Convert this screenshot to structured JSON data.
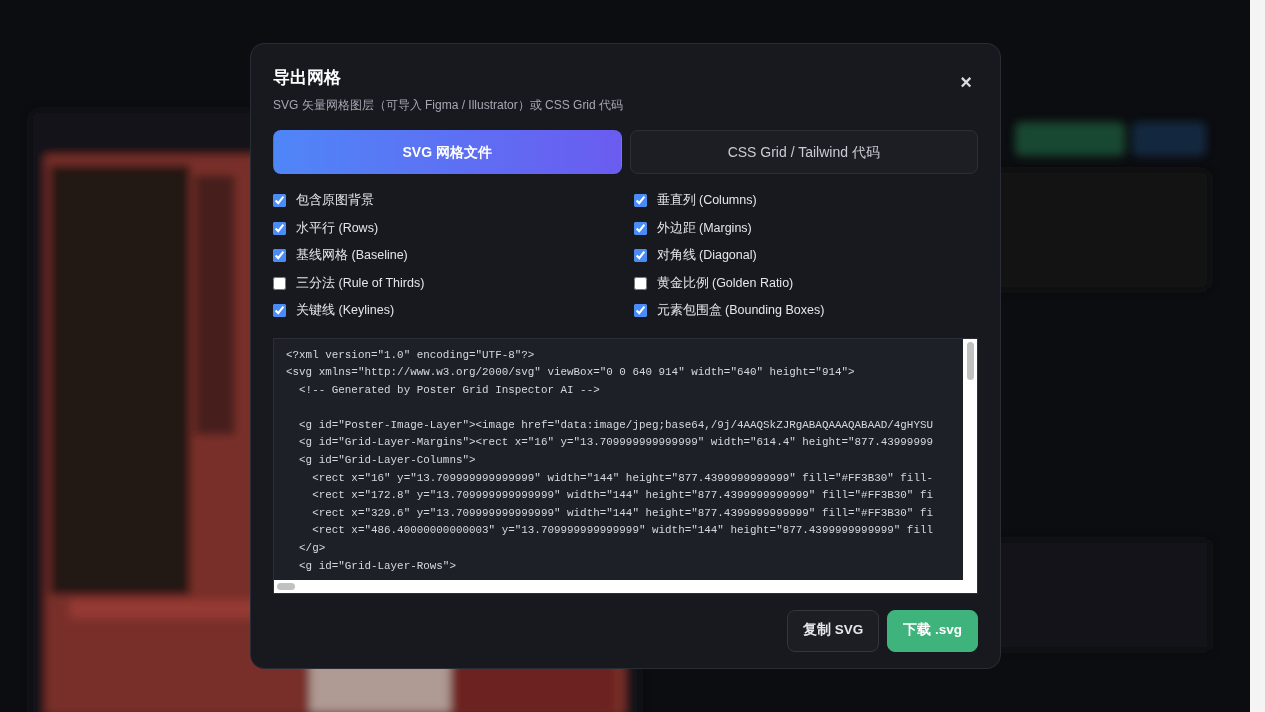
{
  "dialog": {
    "title": "导出网格",
    "subtitle": "SVG 矢量网格图层（可导入 Figma / Illustrator）或 CSS Grid 代码",
    "close": "×"
  },
  "tabs": [
    {
      "label": "SVG 网格文件",
      "selected": true
    },
    {
      "label": "CSS Grid / Tailwind 代码",
      "selected": false
    }
  ],
  "options": [
    {
      "label": "包含原图背景",
      "checked": true
    },
    {
      "label": "垂直列 (Columns)",
      "checked": true
    },
    {
      "label": "水平行 (Rows)",
      "checked": true
    },
    {
      "label": "外边距 (Margins)",
      "checked": true
    },
    {
      "label": "基线网格 (Baseline)",
      "checked": true
    },
    {
      "label": "对角线 (Diagonal)",
      "checked": true
    },
    {
      "label": "三分法 (Rule of Thirds)",
      "checked": false
    },
    {
      "label": "黄金比例 (Golden Ratio)",
      "checked": false
    },
    {
      "label": "关键线 (Keylines)",
      "checked": true
    },
    {
      "label": "元素包围盒 (Bounding Boxes)",
      "checked": true
    }
  ],
  "code": "<?xml version=\"1.0\" encoding=\"UTF-8\"?>\n<svg xmlns=\"http://www.w3.org/2000/svg\" viewBox=\"0 0 640 914\" width=\"640\" height=\"914\">\n  <!-- Generated by Poster Grid Inspector AI -->\n\n  <g id=\"Poster-Image-Layer\"><image href=\"data:image/jpeg;base64,/9j/4AAQSkZJRgABAQAAAQABAAD/4gHYSU\n  <g id=\"Grid-Layer-Margins\"><rect x=\"16\" y=\"13.709999999999999\" width=\"614.4\" height=\"877.43999999\n  <g id=\"Grid-Layer-Columns\">\n    <rect x=\"16\" y=\"13.709999999999999\" width=\"144\" height=\"877.4399999999999\" fill=\"#FF3B30\" fill-\n    <rect x=\"172.8\" y=\"13.709999999999999\" width=\"144\" height=\"877.4399999999999\" fill=\"#FF3B30\" fi\n    <rect x=\"329.6\" y=\"13.709999999999999\" width=\"144\" height=\"877.4399999999999\" fill=\"#FF3B30\" fi\n    <rect x=\"486.40000000000003\" y=\"13.709999999999999\" width=\"144\" height=\"877.4399999999999\" fill\n  </g>\n  <g id=\"Grid-Layer-Rows\">",
  "buttons": [
    {
      "label": "复制 SVG",
      "kind": "secondary"
    },
    {
      "label": "下载 .svg",
      "kind": "primary"
    }
  ]
}
